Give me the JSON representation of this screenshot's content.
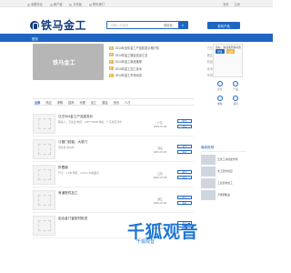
{
  "topbar": {
    "links": [
      "收藏本站",
      "客户端",
      "手机版",
      "联系我们"
    ],
    "right": [
      "登录",
      "注册"
    ]
  },
  "header": {
    "logo_text": "铁马金工",
    "search_placeholder": "请输入关键词",
    "search_scope": "搜全站",
    "publish_button": "发布产品"
  },
  "nav": {
    "first_item": "首页"
  },
  "banner": {
    "logo_text": "铁马金工"
  },
  "headlines": [
    {
      "tag": "热",
      "text": "2014年全年金工产品批发价格行情",
      "right": "行业"
    },
    {
      "tag": "新",
      "text": "2014年金工展会信息汇总",
      "right": "展会"
    },
    {
      "tag": "荐",
      "text": "2014年金工新品推荐",
      "right": "新品"
    },
    {
      "tag": "荐",
      "text": "2014年金工加工技术",
      "right": "技术"
    },
    {
      "tag": "荐",
      "text": "2014年金工市场动态",
      "right": "市场"
    }
  ],
  "sidebar": {
    "hint": "您好，欢迎来到铁马金工",
    "login": "登录",
    "register": "注册",
    "icons": [
      {
        "label": "企业",
        "icon": "company-icon"
      },
      {
        "label": "产品",
        "icon": "product-icon"
      },
      {
        "label": "求购",
        "icon": "buy-icon"
      },
      {
        "label": "资讯",
        "icon": "news-icon"
      }
    ]
  },
  "tabs": [
    "全部",
    "供应",
    "求购",
    "招商",
    "代理",
    "加工",
    "展会",
    "资讯",
    "人才"
  ],
  "listings": [
    {
      "title": "汉王504金工产品批发价",
      "sub": "联系人：王先生  电话：138****0000  地址：广东省东莞市",
      "meta": "广东",
      "date": "2015-07-06",
      "action1": "留言",
      "action2": "询价"
    },
    {
      "title": "订做门铰链，大铁门",
      "sub": "河北省 沧州市",
      "meta": "河北",
      "date": "2015-07-06",
      "action1": "留言",
      "action2": "询价"
    },
    {
      "title": "折叠钢",
      "sub": "尺寸：1.2米 厚度：2.5mm 价格面议",
      "meta": "江苏",
      "date": "2015-07-06",
      "action1": "留言",
      "action2": "询价"
    },
    {
      "title": "有道铁件加工",
      "sub": "",
      "meta": "浙江",
      "date": "2015-07-06",
      "action1": "留言",
      "action2": "询价"
    },
    {
      "title": "铝合金门窗型材批发",
      "sub": "",
      "meta": "山东",
      "date": "2015-07-06",
      "action1": "留言",
      "action2": "询价"
    }
  ],
  "recommend": {
    "title": "最新推荐",
    "items": [
      {
        "text": "五金工具批发市场"
      },
      {
        "text": "金工配件供应"
      },
      {
        "text": "工业铝材加工"
      },
      {
        "text": "不锈钢制品"
      }
    ]
  },
  "watermark": {
    "main": "千狐观音",
    "sub": "千狐观音"
  }
}
